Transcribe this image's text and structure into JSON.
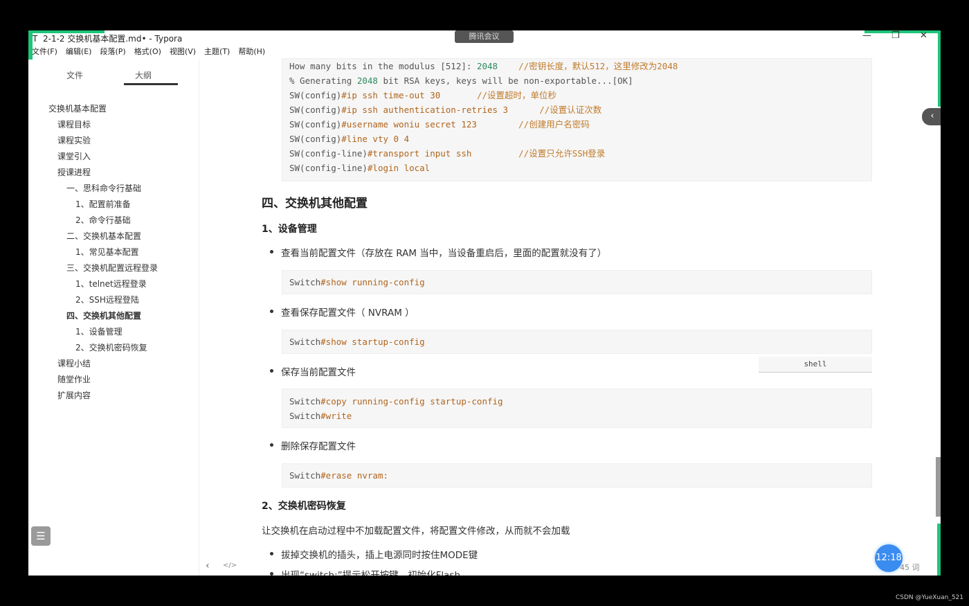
{
  "window": {
    "title": "2-1-2 交换机基本配置.md• - Typora",
    "app_icon": "T",
    "controls": [
      "—",
      "❐",
      "✕"
    ]
  },
  "meeting_tag": "腾讯会议",
  "menu": [
    "文件(F)",
    "编辑(E)",
    "段落(P)",
    "格式(O)",
    "视图(V)",
    "主题(T)",
    "帮助(H)"
  ],
  "sidebar": {
    "tabs": [
      "文件",
      "大纲"
    ],
    "toc": [
      {
        "label": "交换机基本配置",
        "level": 0
      },
      {
        "label": "课程目标",
        "level": 1
      },
      {
        "label": "课程实验",
        "level": 1
      },
      {
        "label": "课堂引入",
        "level": 1
      },
      {
        "label": "授课进程",
        "level": 1
      },
      {
        "label": "一、思科命令行基础",
        "level": 2
      },
      {
        "label": "1、配置前准备",
        "level": 3
      },
      {
        "label": "2、命令行基础",
        "level": 3
      },
      {
        "label": "二、交换机基本配置",
        "level": 2
      },
      {
        "label": "1、常见基本配置",
        "level": 3
      },
      {
        "label": "三、交换机配置远程登录",
        "level": 2
      },
      {
        "label": "1、telnet远程登录",
        "level": 3
      },
      {
        "label": "2、SSH远程登陆",
        "level": 3
      },
      {
        "label": "四、交换机其他配置",
        "level": 2,
        "active": true
      },
      {
        "label": "1、设备管理",
        "level": 3
      },
      {
        "label": "2、交换机密码恢复",
        "level": 3
      },
      {
        "label": "课程小结",
        "level": 1
      },
      {
        "label": "随堂作业",
        "level": 1
      },
      {
        "label": "扩展内容",
        "level": 1
      }
    ]
  },
  "code1": [
    [
      [
        "p",
        "How many bits in the modulus [512]: "
      ],
      [
        "n",
        "2048"
      ],
      [
        "m",
        "    //密钥长度，默认512，这里修改为2048"
      ]
    ],
    [
      [
        "p",
        "% Generating "
      ],
      [
        "n",
        "2048"
      ],
      [
        "p",
        " bit RSA keys, keys will be non-exportable...[OK]"
      ]
    ],
    [
      [
        "p",
        "SW(config)"
      ],
      [
        "k",
        "#ip ssh time-out 30"
      ],
      [
        "m",
        "       //设置超时，单位秒"
      ]
    ],
    [
      [
        "p",
        "SW(config)"
      ],
      [
        "k",
        "#ip ssh authentication-retries 3"
      ],
      [
        "m",
        "      //设置认证次数"
      ]
    ],
    [
      [
        "p",
        "SW(config)"
      ],
      [
        "k",
        "#username woniu secret 123"
      ],
      [
        "m",
        "        //创建用户名密码"
      ]
    ],
    [
      [
        "p",
        "SW(config)"
      ],
      [
        "k",
        "#line vty 0 4"
      ]
    ],
    [
      [
        "p",
        "SW(config-line)"
      ],
      [
        "k",
        "#transport input ssh"
      ],
      [
        "m",
        "         //设置只允许SSH登录"
      ]
    ],
    [
      [
        "p",
        "SW(config-line)"
      ],
      [
        "k",
        "#login local"
      ]
    ]
  ],
  "h2": "四、交换机其他配置",
  "h3a": "1、设备管理",
  "bullets": [
    "查看当前配置文件（存放在 RAM 当中，当设备重启后，里面的配置就没有了）",
    "查看保存配置文件（ NVRAM ）",
    "保存当前配置文件",
    "删除保存配置文件"
  ],
  "codes": [
    [
      [
        [
          "p",
          "Switch"
        ],
        [
          "k",
          "#show running-config"
        ]
      ]
    ],
    [
      [
        [
          "p",
          "Switch"
        ],
        [
          "k",
          "#show startup-config"
        ]
      ]
    ],
    [
      [
        [
          "p",
          "Switch"
        ],
        [
          "k",
          "#copy running-config startup-config"
        ]
      ],
      [
        [
          "p",
          "Switch"
        ],
        [
          "k",
          "#write"
        ]
      ]
    ],
    [
      [
        [
          "p",
          "Switch"
        ],
        [
          "k",
          "#erase nvram:"
        ]
      ]
    ]
  ],
  "lang_tag": "shell",
  "h3b": "2、交换机密码恢复",
  "para": "让交换机在启动过程中不加载配置文件，将配置文件修改，从而就不会加载",
  "bullets2": [
    "拔掉交换机的插头，插上电源同时按住MODE键",
    "出现“switch:”提示松开按键，初始化Flash"
  ],
  "footer": {
    "time": "12:18",
    "word_count": "45 词",
    "back": "‹",
    "source": "</>"
  },
  "watermark": "CSDN @YueXuan_521"
}
